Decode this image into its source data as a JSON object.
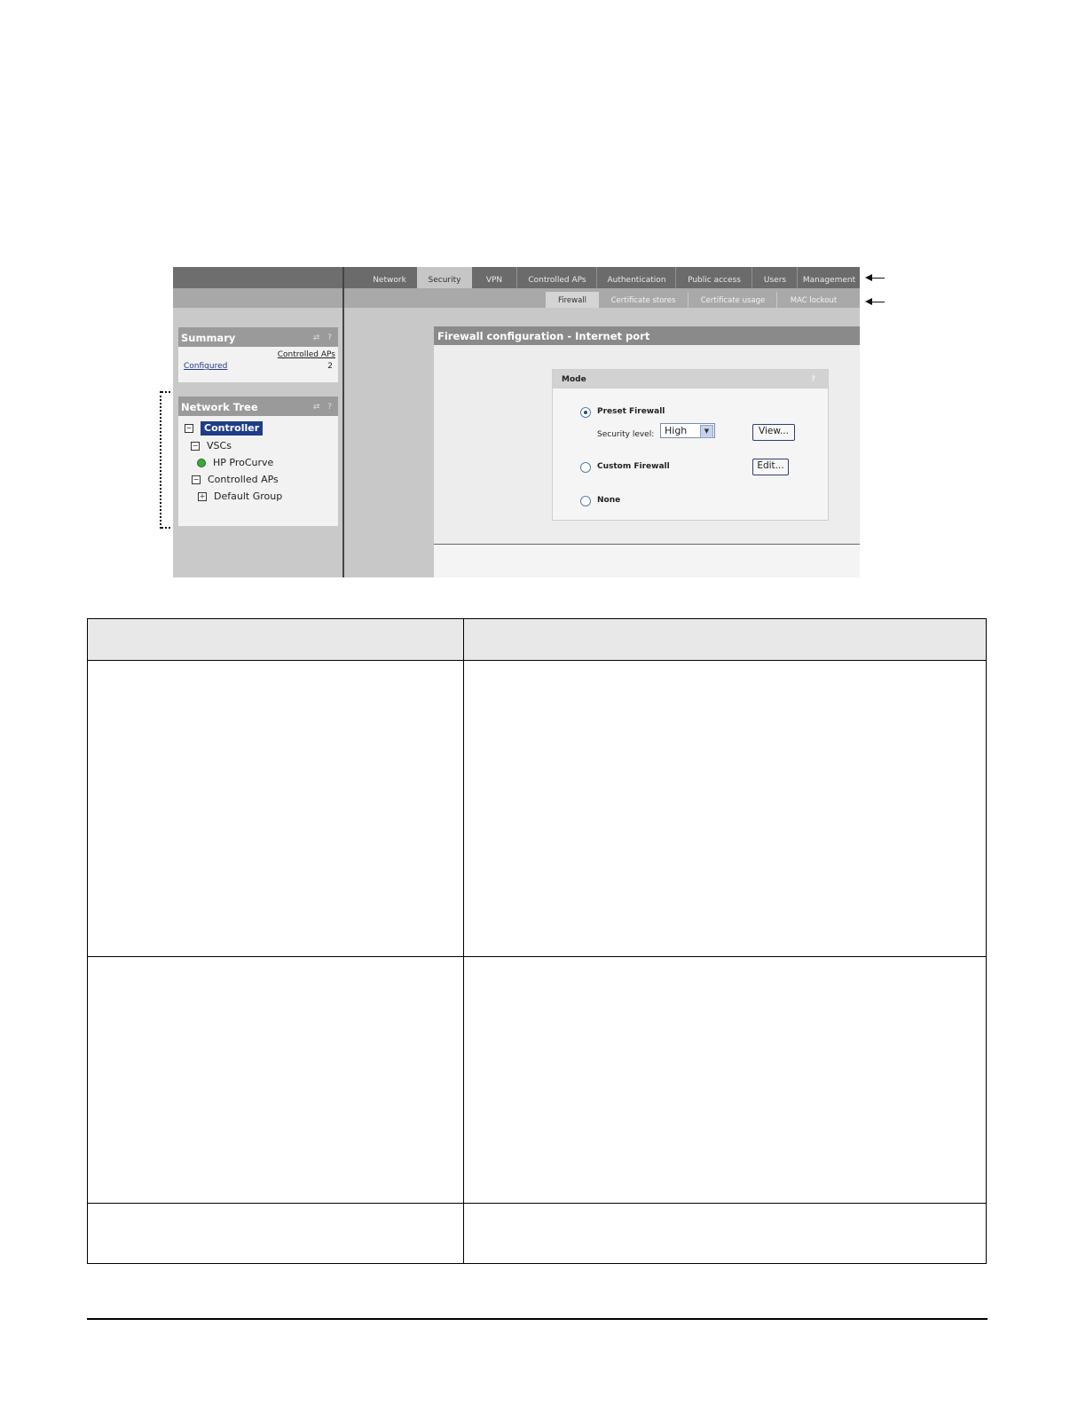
{
  "top_nav": {
    "tabs": [
      {
        "label": "Network",
        "active": false
      },
      {
        "label": "Security",
        "active": true
      },
      {
        "label": "VPN",
        "active": false
      },
      {
        "label": "Controlled APs",
        "active": false
      },
      {
        "label": "Authentication",
        "active": false
      },
      {
        "label": "Public access",
        "active": false
      },
      {
        "label": "Users",
        "active": false
      },
      {
        "label": "Management",
        "active": false
      }
    ]
  },
  "sub_nav": {
    "tabs": [
      {
        "label": "Firewall",
        "active": true
      },
      {
        "label": "Certificate stores",
        "active": false
      },
      {
        "label": "Certificate usage",
        "active": false
      },
      {
        "label": "MAC lockout",
        "active": false
      }
    ]
  },
  "summary": {
    "title": "Summary",
    "column_header": "Controlled APs",
    "row_label": "Configured",
    "row_value": "2"
  },
  "network_tree": {
    "title": "Network Tree",
    "items": [
      {
        "label": "Controller",
        "icon": "minus-box-icon",
        "selected": true
      },
      {
        "label": "VSCs",
        "icon": "minus-box-icon"
      },
      {
        "label": "HP ProCurve",
        "icon": "green-dot-icon"
      },
      {
        "label": "Controlled APs",
        "icon": "minus-box-icon"
      },
      {
        "label": "Default Group",
        "icon": "plus-box-icon"
      }
    ]
  },
  "config": {
    "title": "Firewall configuration - Internet port",
    "mode_title": "Mode",
    "help": "?",
    "preset_label": "Preset Firewall",
    "security_level_label": "Security level:",
    "security_level_value": "High",
    "view_button": "View...",
    "custom_label": "Custom Firewall",
    "edit_button": "Edit...",
    "none_label": "None",
    "selected_mode": "Preset Firewall"
  },
  "colors": {
    "nav_bg": "#6b6b6b",
    "selected_tree_item": "#1f3d87",
    "status_dot": "#3da83d"
  }
}
